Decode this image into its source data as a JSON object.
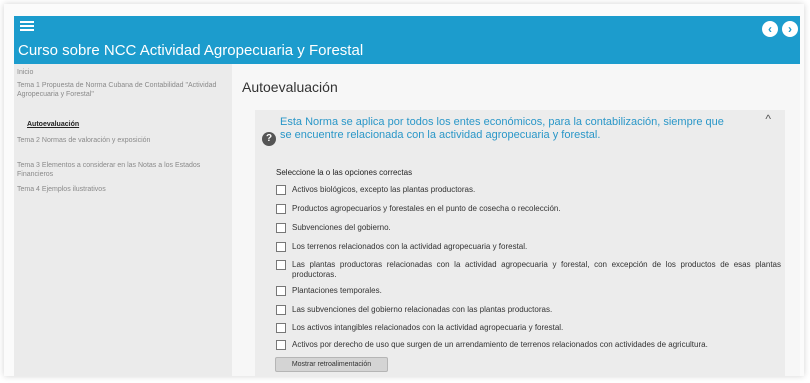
{
  "header": {
    "course_title": "Curso sobre NCC Actividad Agropecuaria y Forestal",
    "prev_label": "‹",
    "next_label": "›"
  },
  "sidebar": {
    "items": [
      {
        "label": "Inicio"
      },
      {
        "label": "Tema 1 Propuesta de Norma Cubana de Contabilidad \"Actividad Agropecuaria y Forestal\""
      },
      {
        "label": "Autoevaluación",
        "active": true
      },
      {
        "label": "Tema 2 Normas de valoración y exposición"
      },
      {
        "label": "Tema 3 Elementos a considerar en las Notas a los Estados Financieros"
      },
      {
        "label": "Tema 4 Ejemplos ilustrativos"
      }
    ]
  },
  "main": {
    "page_title": "Autoevaluación",
    "question": "Esta Norma se aplica por todos los entes económicos, para la contabilización, siempre que se encuentre relacionada con la actividad agropecuaria y forestal.",
    "instruction": "Seleccione la o las opciones correctas",
    "options": [
      {
        "label": "Activos biológicos, excepto las plantas productoras."
      },
      {
        "label": "Productos agropecuarios y forestales en el punto de cosecha o recolección."
      },
      {
        "label": "Subvenciones del gobierno."
      },
      {
        "label": "Los terrenos relacionados con la actividad agropecuaria y forestal."
      },
      {
        "label": "Las plantas productoras relacionadas con la actividad agropecuaria y forestal, con excepción de los productos de esas plantas productoras."
      },
      {
        "label": "Plantaciones temporales."
      },
      {
        "label": "Las subvenciones del gobierno relacionadas con las plantas productoras."
      },
      {
        "label": "Los activos intangibles relacionados con la actividad agropecuaria y forestal."
      },
      {
        "label": "Activos por derecho de uso que surgen de un arrendamiento de terrenos relacionados con actividades de agricultura."
      }
    ],
    "feedback_button": "Mostrar retroalimentación"
  },
  "colors": {
    "header_bg": "#1c9ccd",
    "question_text": "#2a97c8",
    "sidebar_bg": "#ebebeb"
  },
  "icons": {
    "menu": "hamburger-menu-icon",
    "prev": "chevron-left-circle-icon",
    "next": "chevron-right-circle-icon",
    "question": "question-circle-icon",
    "collapse": "chevron-up-icon",
    "checkbox": "checkbox-unchecked-icon"
  }
}
